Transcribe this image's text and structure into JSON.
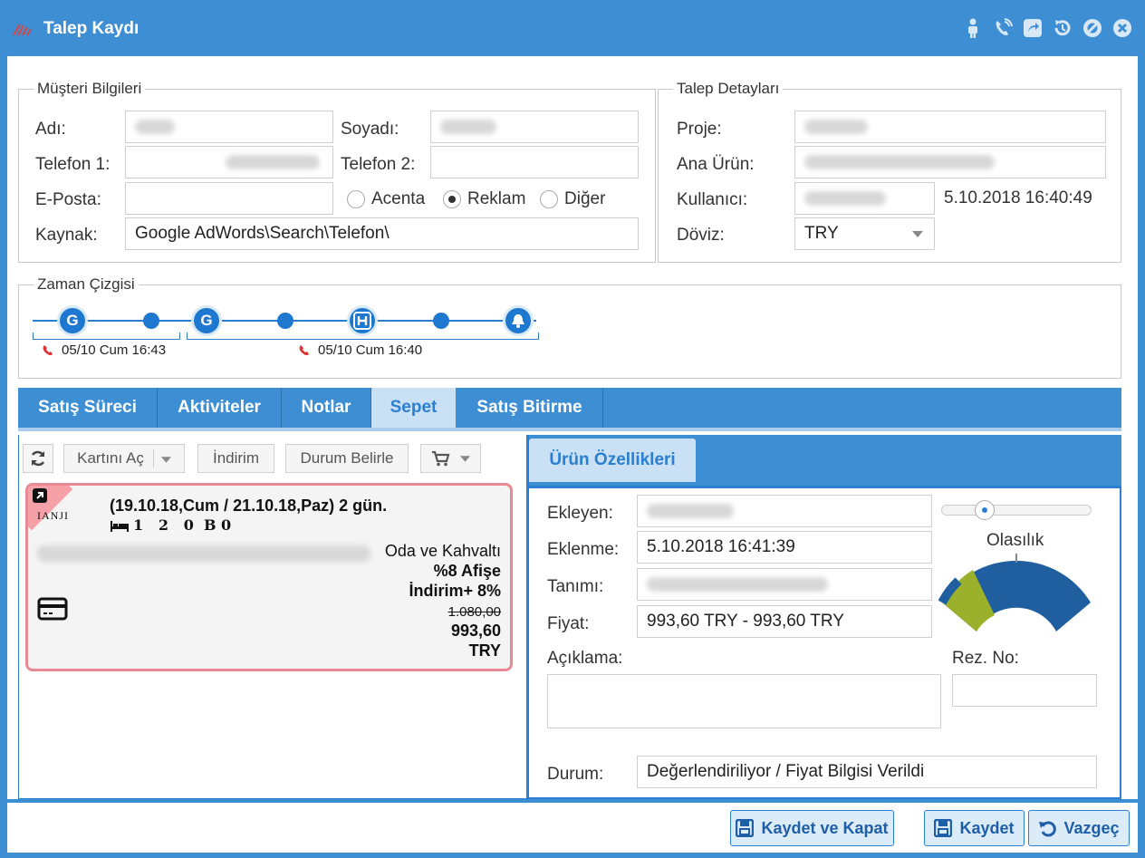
{
  "window": {
    "title": "Talep Kaydı"
  },
  "title_icons": [
    "person-icon",
    "phone-icon",
    "share-icon",
    "history-icon",
    "block-icon",
    "close-icon"
  ],
  "customer": {
    "legend": "Müşteri Bilgileri",
    "name_label": "Adı:",
    "surname_label": "Soyadı:",
    "phone1_label": "Telefon 1:",
    "phone2_label": "Telefon 2:",
    "email_label": "E-Posta:",
    "source_label": "Kaynak:",
    "source_value": "Google AdWords\\Search\\Telefon\\",
    "radio_options": [
      {
        "label": "Acenta",
        "selected": false
      },
      {
        "label": "Reklam",
        "selected": true
      },
      {
        "label": "Diğer",
        "selected": false
      }
    ]
  },
  "request": {
    "legend": "Talep Detayları",
    "project_label": "Proje:",
    "product_label": "Ana Ürün:",
    "user_label": "Kullanıcı:",
    "user_timestamp": "5.10.2018 16:40:49",
    "currency_label": "Döviz:",
    "currency_value": "TRY"
  },
  "timeline": {
    "legend": "Zaman Çizgisi",
    "nodes": [
      "G",
      "",
      "G",
      "",
      "H",
      "",
      "bell"
    ],
    "entries": [
      {
        "text": "05/10 Cum 16:43"
      },
      {
        "text": "05/10 Cum 16:40"
      }
    ]
  },
  "tabs": [
    {
      "label": "Satış Süreci",
      "active": false
    },
    {
      "label": "Aktiviteler",
      "active": false
    },
    {
      "label": "Notlar",
      "active": false
    },
    {
      "label": "Sepet",
      "active": true
    },
    {
      "label": "Satış Bitirme",
      "active": false
    }
  ],
  "cart_toolbar": {
    "open_card": "Kartını Aç",
    "discount": "İndirim",
    "set_status": "Durum Belirle"
  },
  "cart_item": {
    "dates": "(19.10.18,Cum / 21.10.18,Paz) 2 gün.",
    "occupancy": "1   2   0  B 0",
    "board": "Oda ve Kahvaltı",
    "poster": "%8 Afişe",
    "discount": "İndirim+ 8%",
    "old_price": "1.080,00",
    "price": "993,60",
    "currency": "TRY",
    "logo_text": "IANJI"
  },
  "product": {
    "tab_label": "Ürün Özellikleri",
    "added_by_label": "Ekleyen:",
    "added_at_label": "Eklenme:",
    "added_at_value": "5.10.2018 16:41:39",
    "desc_label": "Tanımı:",
    "price_label": "Fiyat:",
    "price_value": "993,60 TRY - 993,60 TRY",
    "note_label": "Açıklama:",
    "rez_label": "Rez. No:",
    "status_label": "Durum:",
    "status_value": "Değerlendiriliyor / Fiyat Bilgisi Verildi",
    "probability_label": "Olasılık",
    "probability": 0.2
  },
  "footer": {
    "save_close": "Kaydet ve Kapat",
    "save": "Kaydet",
    "cancel": "Vazgeç"
  }
}
